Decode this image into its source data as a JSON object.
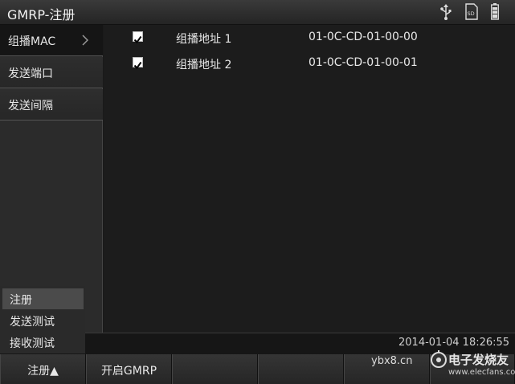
{
  "window": {
    "title": "GMRP-注册"
  },
  "status_icons": [
    "usb-icon",
    "sd-card-icon",
    "battery-icon"
  ],
  "sd_label": "SD",
  "sidebar": {
    "items": [
      {
        "label": "组播MAC",
        "active": true
      },
      {
        "label": "发送端口"
      },
      {
        "label": "发送间隔"
      }
    ]
  },
  "main": {
    "rows": [
      {
        "checked": true,
        "name": "组播地址 1",
        "address": "01-0C-CD-01-00-00"
      },
      {
        "checked": true,
        "name": "组播地址 2",
        "address": "01-0C-CD-01-00-01"
      }
    ]
  },
  "popup_menu": {
    "items": [
      {
        "label": "注册",
        "selected": true
      },
      {
        "label": "发送测试"
      },
      {
        "label": "接收测试"
      }
    ]
  },
  "status": {
    "timestamp": "2014-01-04 18:26:55"
  },
  "bottom_bar": {
    "keys": [
      {
        "label": "注册▲"
      },
      {
        "label": "开启GMRP"
      },
      {
        "label": ""
      },
      {
        "label": ""
      },
      {
        "label": ""
      },
      {
        "label": ""
      }
    ]
  },
  "watermark": {
    "text": "ybx8.cn",
    "site_name": "电子发烧友",
    "url": "www.elecfans.com"
  },
  "colors": {
    "background": "#1c1c1c",
    "sidebar": "#2b2b2b",
    "text": "#e8e8e8",
    "selected": "#4b4b4b"
  }
}
